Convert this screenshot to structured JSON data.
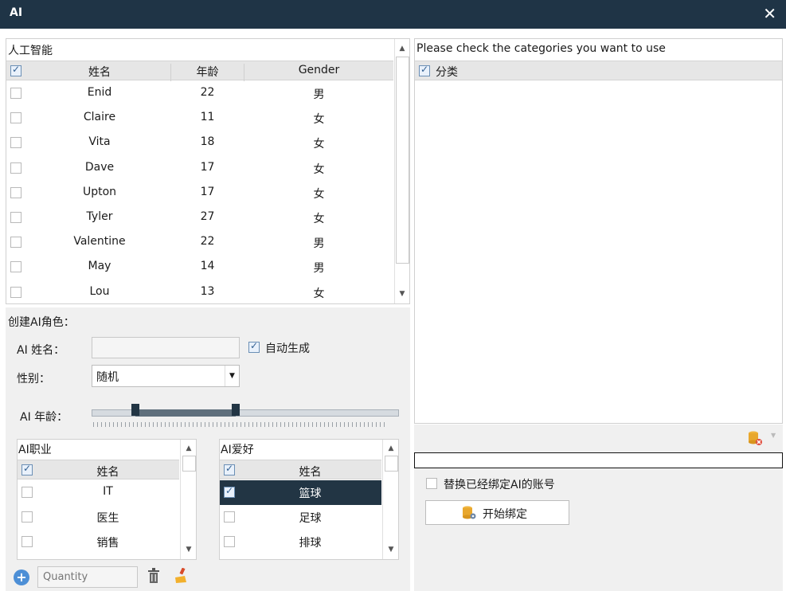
{
  "window": {
    "title": "AI"
  },
  "ai_grid": {
    "title": "人工智能",
    "columns": [
      "姓名",
      "年龄",
      "Gender"
    ],
    "rows": [
      {
        "name": "Enid",
        "age": "22",
        "gender": "男"
      },
      {
        "name": "Claire",
        "age": "11",
        "gender": "女"
      },
      {
        "name": "Vita",
        "age": "18",
        "gender": "女"
      },
      {
        "name": "Dave",
        "age": "17",
        "gender": "女"
      },
      {
        "name": "Upton",
        "age": "17",
        "gender": "女"
      },
      {
        "name": "Tyler",
        "age": "27",
        "gender": "女"
      },
      {
        "name": "Valentine",
        "age": "22",
        "gender": "男"
      },
      {
        "name": "May",
        "age": "14",
        "gender": "男"
      },
      {
        "name": "Lou",
        "age": "13",
        "gender": "女"
      }
    ]
  },
  "create_form": {
    "section_title": "创建AI角色：",
    "name_label": "AI 姓名：",
    "auto_generate_label": "自动生成",
    "auto_generate_checked": true,
    "gender_label": "性别：",
    "gender_value": "随机",
    "age_label": "AI 年龄："
  },
  "job_list": {
    "title": "AI职业",
    "column": "姓名",
    "items": [
      "IT",
      "医生",
      "销售"
    ]
  },
  "hobby_list": {
    "title": "AI爱好",
    "column": "姓名",
    "items": [
      "篮球",
      "足球",
      "排球"
    ],
    "selected_index": 0
  },
  "bottom_toolbar": {
    "quantity_placeholder": "Quantity"
  },
  "category_panel": {
    "instruction": "Please check the categories you want to use",
    "column": "分类"
  },
  "bind_section": {
    "replace_label": "替换已经绑定AI的账号",
    "start_bind_label": "开始绑定"
  },
  "colors": {
    "titlebar": "#1f3446",
    "selected_row": "#223544"
  }
}
